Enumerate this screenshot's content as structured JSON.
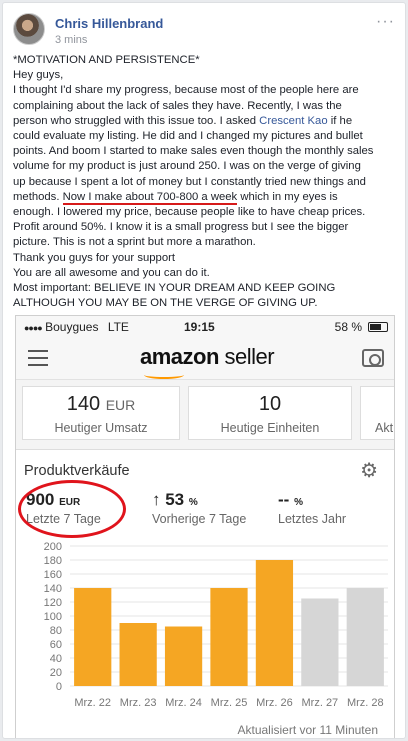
{
  "post": {
    "author": "Chris Hillenbrand",
    "time": "3 mins",
    "more": "···",
    "lines": [
      "*MOTIVATION AND PERSISTENCE*",
      "Hey guys,",
      "I thought I'd share my progress, because most of the people here are",
      "complaining about the lack of sales they have. Recently, I was the",
      "could evaluate my listing. He did and I changed my pictures and bullet",
      "points. And boom I started to make sales even though the monthly sales",
      "volume for my product is just around 250. I was on the verge of giving",
      "up because I spent a lot of money but I constantly tried new things and",
      "enough. I lowered my price, because people like to have cheap prices.",
      "Profit around 50%. I know it is a small progress but I see the bigger",
      "picture. This is not a sprint but more a marathon.",
      "Thank you guys for your support",
      "You are all awesome and you can do it.",
      "Most important: BELIEVE IN YOUR DREAM AND KEEP GOING",
      "ALTHOUGH YOU MAY BE ON THE VERGE OF GIVING UP."
    ],
    "line_person_pre": "person who struggled with this issue too. I asked ",
    "line_person_link": "Crescent Kao",
    "line_person_post": " if he",
    "line_methods_pre": "methods. ",
    "line_methods_underlined": "Now I make about 700-800 a week",
    "line_methods_post": " which in my eyes is"
  },
  "phone": {
    "carrier": "Bouygues",
    "network": "LTE",
    "time": "19:15",
    "battery": "58 %",
    "logo_amazon": "amazon",
    "logo_seller": "seller",
    "cards": [
      {
        "value": "140",
        "unit": "EUR",
        "label": "Heutiger Umsatz"
      },
      {
        "value": "10",
        "unit": "",
        "label": "Heutige Einheiten"
      },
      {
        "value": "",
        "unit": "",
        "label": "Akt"
      }
    ],
    "panel_title": "Produktverkäufe",
    "metrics": [
      {
        "value": "900",
        "unit": "EUR",
        "label": "Letzte 7 Tage"
      },
      {
        "value": "↑ 53",
        "unit": "%",
        "label": "Vorherige 7 Tage"
      },
      {
        "value": "--",
        "unit": "%",
        "label": "Letztes Jahr"
      }
    ],
    "updated": "Aktualisiert vor 11 Minuten"
  },
  "colors": {
    "accent": "#f5a623",
    "gray_bar": "#d6d6d6",
    "highlight": "#e0141c",
    "link": "#365899"
  },
  "chart_data": {
    "type": "bar",
    "categories": [
      "Mrz. 22",
      "Mrz. 23",
      "Mrz. 24",
      "Mrz. 25",
      "Mrz. 26",
      "Mrz. 27",
      "Mrz. 28"
    ],
    "series": [
      {
        "values": [
          140,
          90,
          85,
          140,
          180,
          125,
          140
        ],
        "colors": [
          "#f5a623",
          "#f5a623",
          "#f5a623",
          "#f5a623",
          "#f5a623",
          "#d6d6d6",
          "#d6d6d6"
        ]
      }
    ],
    "yticks": [
      0,
      20,
      40,
      60,
      80,
      100,
      120,
      140,
      160,
      180,
      200
    ],
    "ylim": [
      0,
      200
    ],
    "grid": true
  }
}
